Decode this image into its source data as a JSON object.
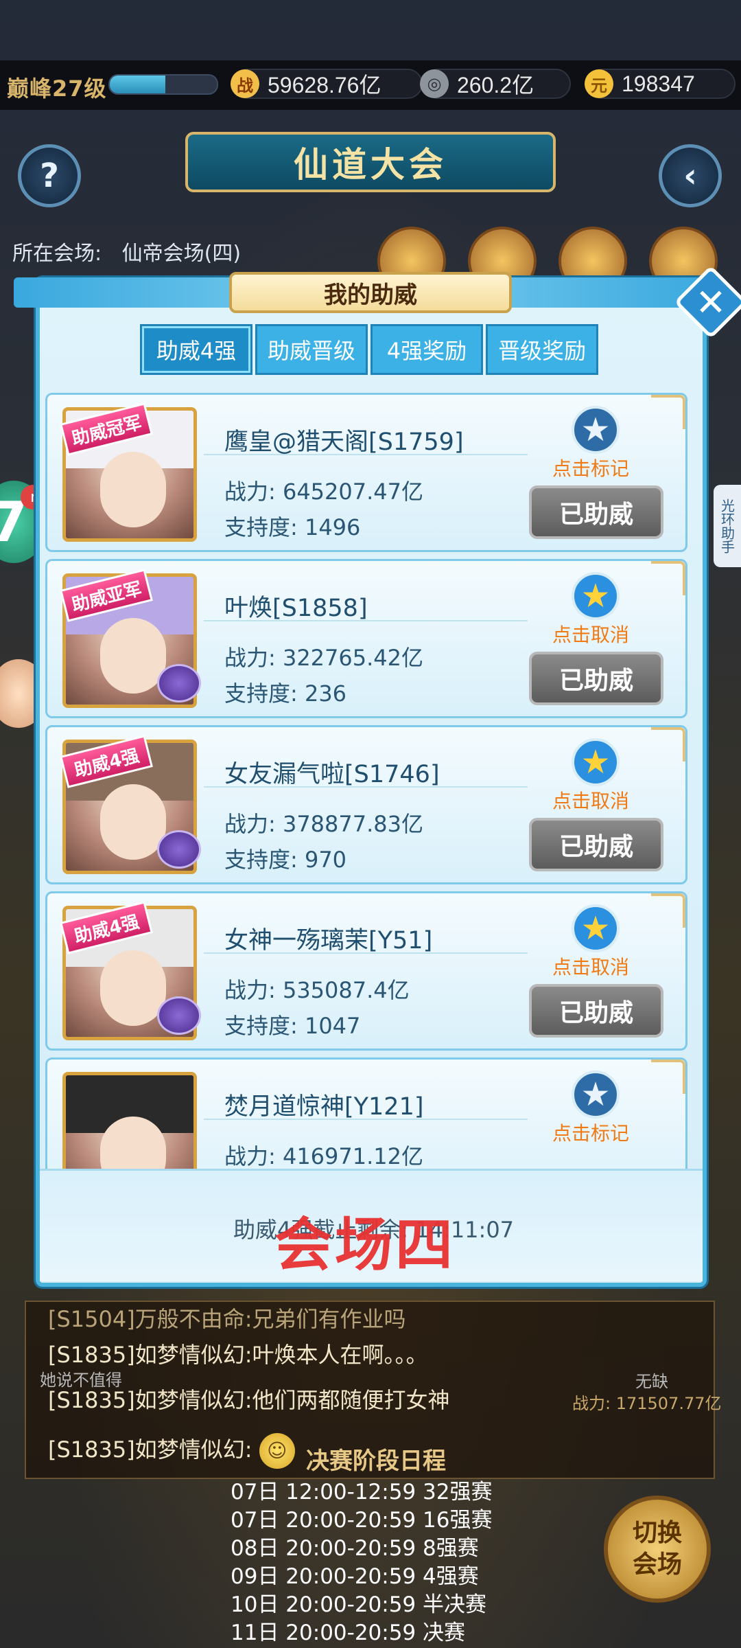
{
  "hud": {
    "level_label": "巅峰27级",
    "level_progress": 0.52,
    "resources": [
      {
        "icon": "battle-power-icon",
        "glyph": "战",
        "value": "59628.76亿"
      },
      {
        "icon": "copper-coin-icon",
        "glyph": "◎",
        "value": "260.2亿"
      },
      {
        "icon": "gold-ingot-icon",
        "glyph": "元",
        "value": "198347"
      }
    ],
    "help_glyph": "?",
    "back_glyph": "‹"
  },
  "page": {
    "title": "仙道大会",
    "venue_label": "所在会场:",
    "venue_value": "仙帝会场(四)"
  },
  "side": {
    "left_widget_glyph": "7",
    "new_badge": "new",
    "right_tab": "光环助手"
  },
  "modal": {
    "title": "我的助威",
    "close_glyph": "✕",
    "tabs": [
      {
        "label": "助威4强",
        "active": true
      },
      {
        "label": "助威晋级",
        "active": false
      },
      {
        "label": "4强奖励",
        "active": false
      },
      {
        "label": "晋级奖励",
        "active": false
      }
    ],
    "cards": [
      {
        "rank": "助威冠军",
        "name": "鹰皇@猎天阁[S1759]",
        "power": "战力: 645207.47亿",
        "support": "支持度: 1496",
        "mark": "点击标记",
        "starred": false,
        "button": "已助威",
        "hair": "#f0f0f5"
      },
      {
        "rank": "助威亚军",
        "name": "叶焕[S1858]",
        "power": "战力: 322765.42亿",
        "support": "支持度: 236",
        "mark": "点击取消",
        "starred": true,
        "button": "已助威",
        "hair": "#b9a8e6"
      },
      {
        "rank": "助威4强",
        "name": "女友漏气啦[S1746]",
        "power": "战力: 378877.83亿",
        "support": "支持度: 970",
        "mark": "点击取消",
        "starred": true,
        "button": "已助威",
        "hair": "#8a6e5c"
      },
      {
        "rank": "助威4强",
        "name": "女神一殇璃茉[Y51]",
        "power": "战力: 535087.4亿",
        "support": "支持度: 1047",
        "mark": "点击取消",
        "starred": true,
        "button": "已助威",
        "hair": "#e8e8e8"
      },
      {
        "rank": "",
        "name": "焚月道惊神[Y121]",
        "power": "战力: 416971.12亿",
        "support": "",
        "mark": "点击标记",
        "starred": false,
        "button": "",
        "hair": "#2a2a2a"
      }
    ],
    "countdown": "助威4强截止剩余: 14:11:07"
  },
  "overlay_watermark": "会场四",
  "chat": {
    "lines": [
      "[S1504]万般不由命:兄弟们有作业吗",
      "[S1835]如梦情似幻:叶焕本人在啊。。。",
      "[S1835]如梦情似幻:他们两都随便打女神",
      "[S1835]如梦情似幻:"
    ],
    "bg_left": "她说不值得",
    "bg_right": "无缺",
    "bg_right_power": "战力: 171507.77亿"
  },
  "schedule": {
    "title": "决赛阶段日程",
    "rows": [
      "07日 12:00-12:59 32强赛",
      "07日 20:00-20:59 16强赛",
      "08日 20:00-20:59 8强赛",
      "09日 20:00-20:59 4强赛",
      "10日 20:00-20:59 半决赛",
      "11日 20:00-20:59 决赛"
    ]
  },
  "switch_button": "切换\n会场"
}
